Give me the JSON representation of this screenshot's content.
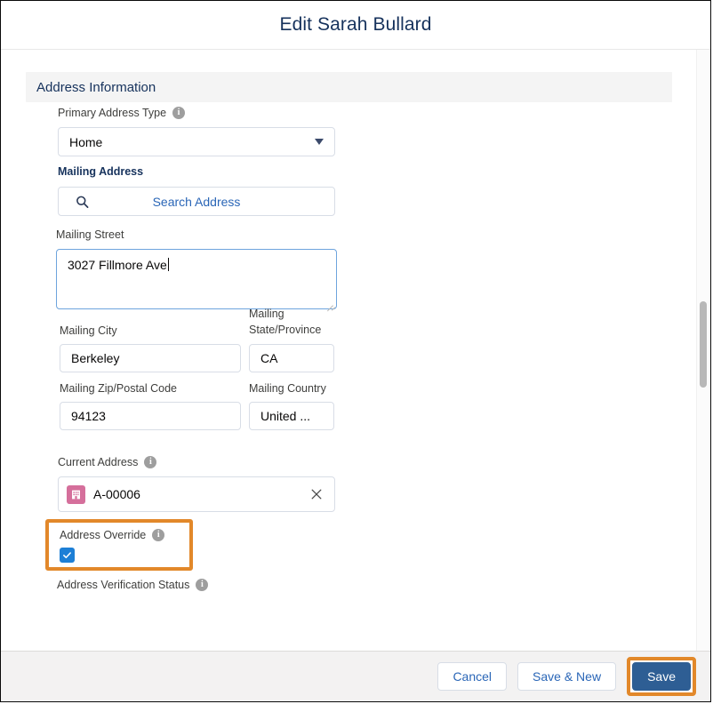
{
  "header": {
    "title": "Edit Sarah Bullard"
  },
  "section": {
    "title": "Address Information"
  },
  "fields": {
    "primary_address_type": {
      "label": "Primary Address Type",
      "value": "Home",
      "info": "i"
    },
    "mailing_address": {
      "label": "Mailing Address",
      "search_label": "Search Address"
    },
    "mailing_street": {
      "label": "Mailing Street",
      "value": "3027 Fillmore Ave"
    },
    "mailing_city": {
      "label": "Mailing City",
      "value": "Berkeley"
    },
    "mailing_state": {
      "label_line1": "Mailing",
      "label_line2": "State/Province",
      "value": "CA"
    },
    "mailing_zip": {
      "label": "Mailing Zip/Postal Code",
      "value": "94123"
    },
    "mailing_country": {
      "label": "Mailing Country",
      "value": "United ..."
    },
    "current_address": {
      "label": "Current Address",
      "value": "A-00006",
      "info": "i"
    },
    "address_override": {
      "label": "Address Override",
      "info": "i",
      "checked": true
    },
    "address_verification_status": {
      "label": "Address Verification Status",
      "info": "i"
    }
  },
  "footer": {
    "cancel_label": "Cancel",
    "save_new_label": "Save & New",
    "save_label": "Save"
  },
  "colors": {
    "brand_blue": "#2e5e94",
    "link_blue": "#2a66b7",
    "highlight_orange": "#e2882a",
    "checkbox_blue": "#1d7fd6",
    "record_pink": "#d56f9b"
  }
}
